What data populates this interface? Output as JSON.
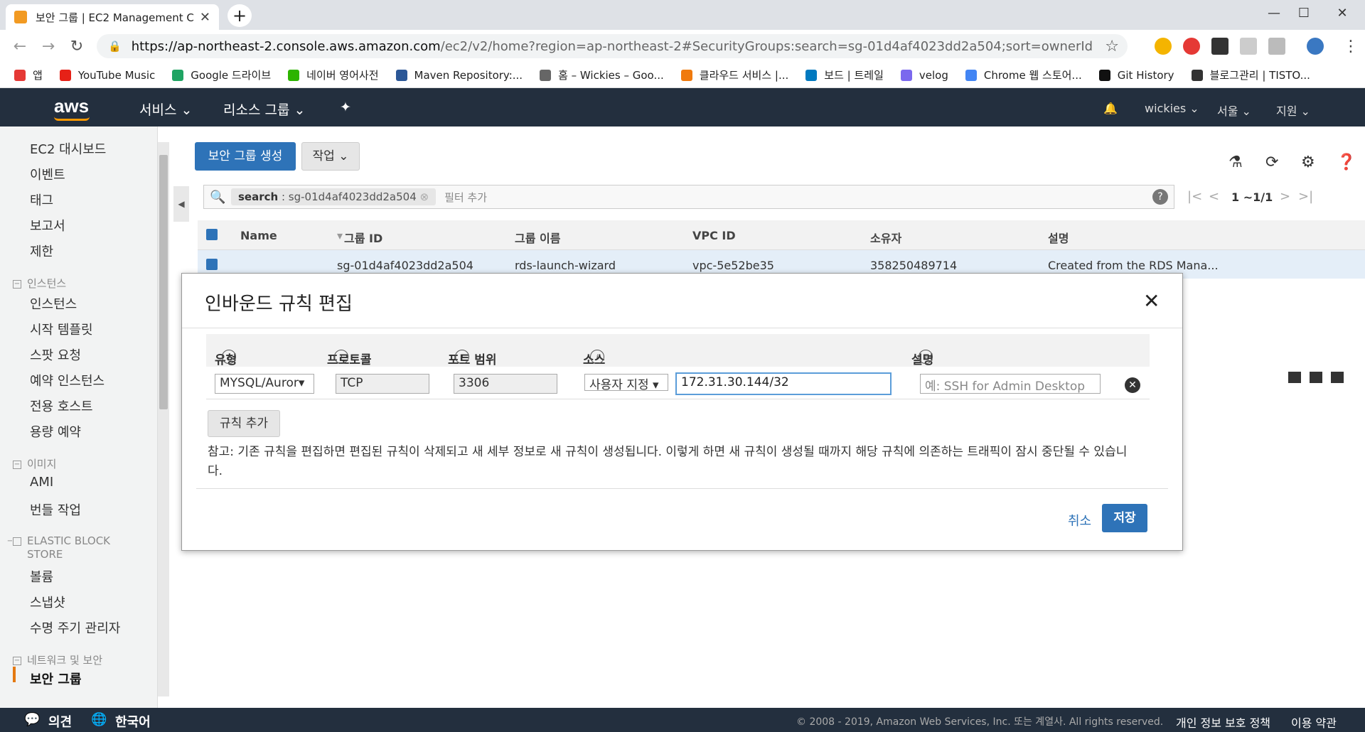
{
  "browser": {
    "tab_title": "보안 그룹 | EC2 Management C",
    "tab_close": "✕",
    "new_tab": "+",
    "win_min": "—",
    "win_max": "☐",
    "win_close": "✕",
    "url_domain": "https://ap-northeast-2.console.aws.amazon.com",
    "url_rest": "/ec2/v2/home?region=ap-northeast-2#SecurityGroups:search=sg-01d4af4023dd2a504;sort=ownerId",
    "back": "←",
    "forward": "→",
    "reload": "↻",
    "star": "☆",
    "lock": "🔒"
  },
  "bookmarks": [
    {
      "label": "앱",
      "color": "#e53935"
    },
    {
      "label": "YouTube Music",
      "color": "#e62117"
    },
    {
      "label": "Google 드라이브",
      "color": "#1fa463"
    },
    {
      "label": "네이버 영어사전",
      "color": "#2db400"
    },
    {
      "label": "Maven Repository:...",
      "color": "#2b5797"
    },
    {
      "label": "홈 – Wickies – Goo...",
      "color": "#666666"
    },
    {
      "label": "클라우드 서비스 |...",
      "color": "#f07a0d"
    },
    {
      "label": "보드 | 트레일",
      "color": "#0079bf"
    },
    {
      "label": "velog",
      "color": "#7b68ee"
    },
    {
      "label": "Chrome 웹 스토어...",
      "color": "#4285f4"
    },
    {
      "label": "Git History",
      "color": "#111111"
    },
    {
      "label": "블로그관리 | TISTO...",
      "color": "#333333"
    }
  ],
  "awsnav": {
    "logo": "aws",
    "services": "서비스 ⌄",
    "resource_groups": "리소스 그룹 ⌄",
    "pin": "✦",
    "bell": "🔔",
    "user": "wickies ⌄",
    "region": "서울 ⌄",
    "support": "지원 ⌄"
  },
  "sidebar": {
    "top": [
      "EC2 대시보드",
      "이벤트",
      "태그",
      "보고서",
      "제한"
    ],
    "instances_title": "인스턴스",
    "instances": [
      "인스턴스",
      "시작 템플릿",
      "스팟 요청",
      "예약 인스턴스",
      "전용 호스트",
      "용량 예약"
    ],
    "images_title": "이미지",
    "images": [
      "AMI",
      "번들 작업"
    ],
    "ebs_title": "ELASTIC BLOCK STORE",
    "ebs": [
      "볼륨",
      "스냅샷",
      "수명 주기 관리자"
    ],
    "network_title": "네트워크 및 보안",
    "network": [
      "보안 그룹"
    ]
  },
  "toolbar": {
    "create": "보안 그룹 생성",
    "actions": "작업 ⌄"
  },
  "search": {
    "key": "search",
    "value": "sg-01d4af4023dd2a504",
    "add_filter": "필터 추가",
    "pager": "1 ~1/1"
  },
  "table": {
    "headers": [
      "Name",
      "그룹 ID",
      "그룹 이름",
      "VPC ID",
      "소유자",
      "설명"
    ],
    "row": [
      "",
      "sg-01d4af4023dd2a504",
      "rds-launch-wizard",
      "vpc-5e52be35",
      "358250489714",
      "Created from the RDS Mana..."
    ]
  },
  "modal": {
    "title": "인바운드 규칙 편집",
    "close": "✕",
    "headers": {
      "type": "유형",
      "protocol": "프로토콜",
      "port": "포트 범위",
      "source": "소스",
      "desc": "설명"
    },
    "row": {
      "type": "MYSQL/Auror▾",
      "protocol": "TCP",
      "port": "3306",
      "source_select": "사용자 지정 ▾",
      "source_value": "172.31.30.144/32",
      "desc_placeholder": "예: SSH for Admin Desktop"
    },
    "add_rule": "규칙 추가",
    "note": "참고: 기존 규칙을 편집하면 편집된 규칙이 삭제되고 새 세부 정보로 새 규칙이 생성됩니다. 이렇게 하면 새 규칙이 생성될 때까지 해당 규칙에 의존하는 트래픽이 잠시 중단될 수 있습니다.",
    "cancel": "취소",
    "save": "저장"
  },
  "footer": {
    "feedback": "의견",
    "language": "한국어",
    "copyright": "© 2008 - 2019, Amazon Web Services, Inc. 또는 계열사. All rights reserved.",
    "privacy": "개인 정보 보호 정책",
    "terms": "이용 약관"
  }
}
